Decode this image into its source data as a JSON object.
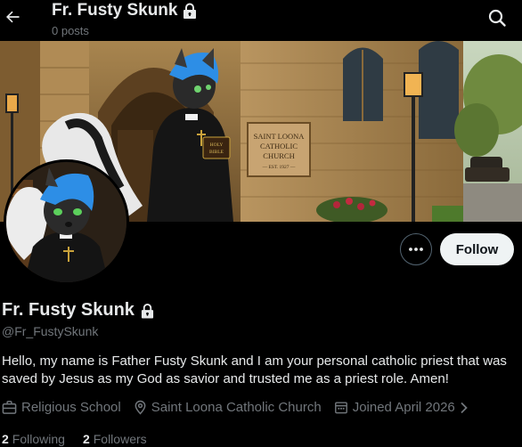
{
  "header": {
    "title": "Fr. Fusty Skunk",
    "post_count": "0 posts"
  },
  "banner": {
    "sign_lines": [
      "SAINT LOONA",
      "CATHOLIC",
      "CHURCH",
      "— EST. 1927 —"
    ],
    "book_lines": [
      "HOLY",
      "BIBLE"
    ]
  },
  "actions": {
    "more_icon": "ellipsis-icon",
    "follow_label": "Follow"
  },
  "profile": {
    "display_name": "Fr. Fusty Skunk",
    "handle": "@Fr_FustySkunk",
    "bio": "Hello, my name is Father Fusty Skunk and I am your personal catholic priest that was saved by Jesus as my God as savior and trusted me as a priest role. Amen!",
    "category": "Religious School",
    "location": "Saint Loona Catholic Church",
    "joined": "Joined April 2026"
  },
  "stats": {
    "following_count": "2",
    "following_label": "Following",
    "followers_count": "2",
    "followers_label": "Followers"
  },
  "colors": {
    "background": "#000000",
    "primary_text": "#e7e9ea",
    "secondary_text": "#71767b",
    "follow_button_bg": "#eff3f4"
  }
}
